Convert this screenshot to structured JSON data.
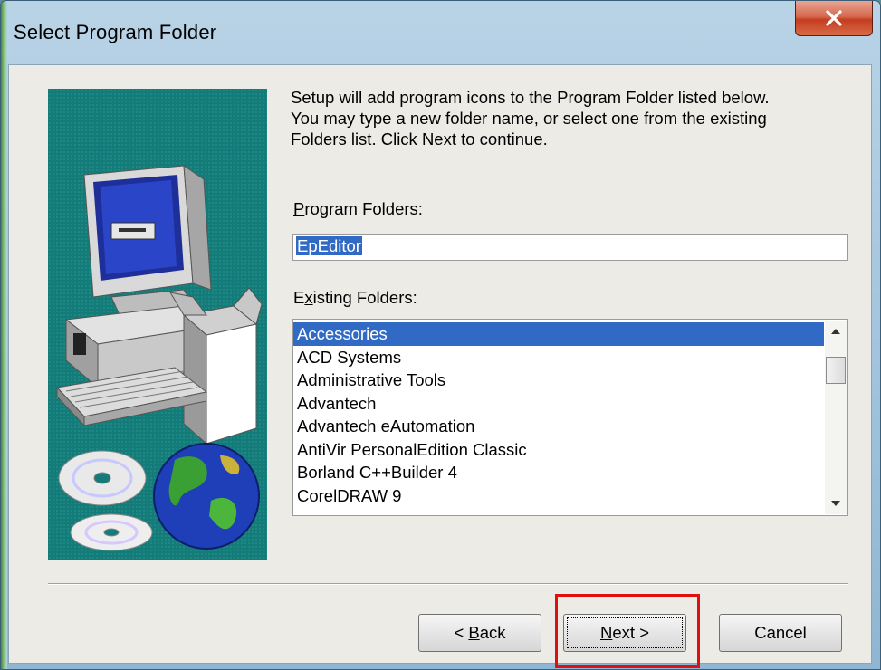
{
  "window": {
    "title": "Select Program Folder",
    "close_icon": "close-icon"
  },
  "intro": {
    "line1": "Setup will add program icons to the Program Folder listed below.",
    "line2": "You may type a new folder name, or select one from the existing",
    "line3": "Folders list.  Click Next to continue."
  },
  "program_folders": {
    "label_mn": "P",
    "label_rest": "rogram Folders:",
    "value": "EpEditor"
  },
  "existing_folders": {
    "label_pre": "E",
    "label_mn": "x",
    "label_rest": "isting Folders:",
    "items": [
      "Accessories",
      "ACD Systems",
      "Administrative Tools",
      "Advantech",
      "Advantech eAutomation",
      "AntiVir PersonalEdition Classic",
      "Borland C++Builder 4",
      "CorelDRAW 9"
    ],
    "selected_index": 0
  },
  "buttons": {
    "back_prefix": "< ",
    "back_mn": "B",
    "back_rest": "ack",
    "next_mn": "N",
    "next_rest": "ext >",
    "cancel": "Cancel"
  },
  "colors": {
    "selection": "#316ac5",
    "highlight_box": "#e01010",
    "art_background": "#147b78"
  }
}
